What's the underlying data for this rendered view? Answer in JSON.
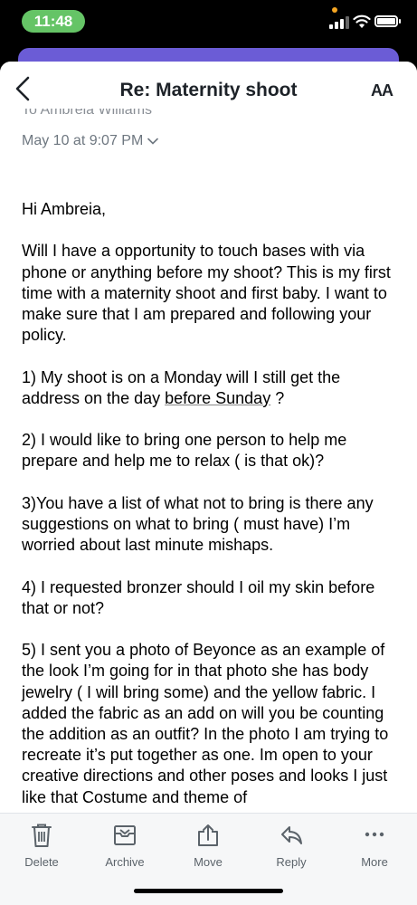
{
  "status_bar": {
    "time": "11:48"
  },
  "nav": {
    "title": "Re: Maternity shoot",
    "text_size_label": "AA"
  },
  "email": {
    "to_line": "To Ambreia Williams",
    "date": "May 10 at 9:07 PM",
    "greeting": "Hi Ambreia,",
    "p1": "Will I have a opportunity to touch bases with via phone or anything before my shoot? This is my first time with a maternity shoot and first baby. I want to make sure that I am prepared and following your policy.",
    "p2_before": "1) My shoot is on a Monday will I still get the address on the day ",
    "p2_link": "before Sunday",
    "p2_after": " ?",
    "p3": "2) I would like to bring one person to help me prepare and help me to relax ( is that ok)?",
    "p4": "3)You have a list of what not to bring is there any suggestions on what to bring ( must have) I’m worried about last minute mishaps.",
    "p5": "4) I requested bronzer should I oil my skin before that or not?",
    "p6": "5) I sent you a photo of Beyonce as an example of the look I’m going for in that photo she has body jewelry ( I will bring some) and the yellow fabric. I added the fabric as an add on will you be counting the addition as an outfit?  In the photo I am trying to recreate it’s put together as one.  Im open to your creative directions and other poses and looks I just like that Costume and theme of"
  },
  "toolbar": {
    "delete": "Delete",
    "archive": "Archive",
    "move": "Move",
    "reply": "Reply",
    "more": "More"
  },
  "colors": {
    "accent_green": "#65c466",
    "stack_purple": "#6b5cd6",
    "toolbar_icon": "#5b636a"
  }
}
